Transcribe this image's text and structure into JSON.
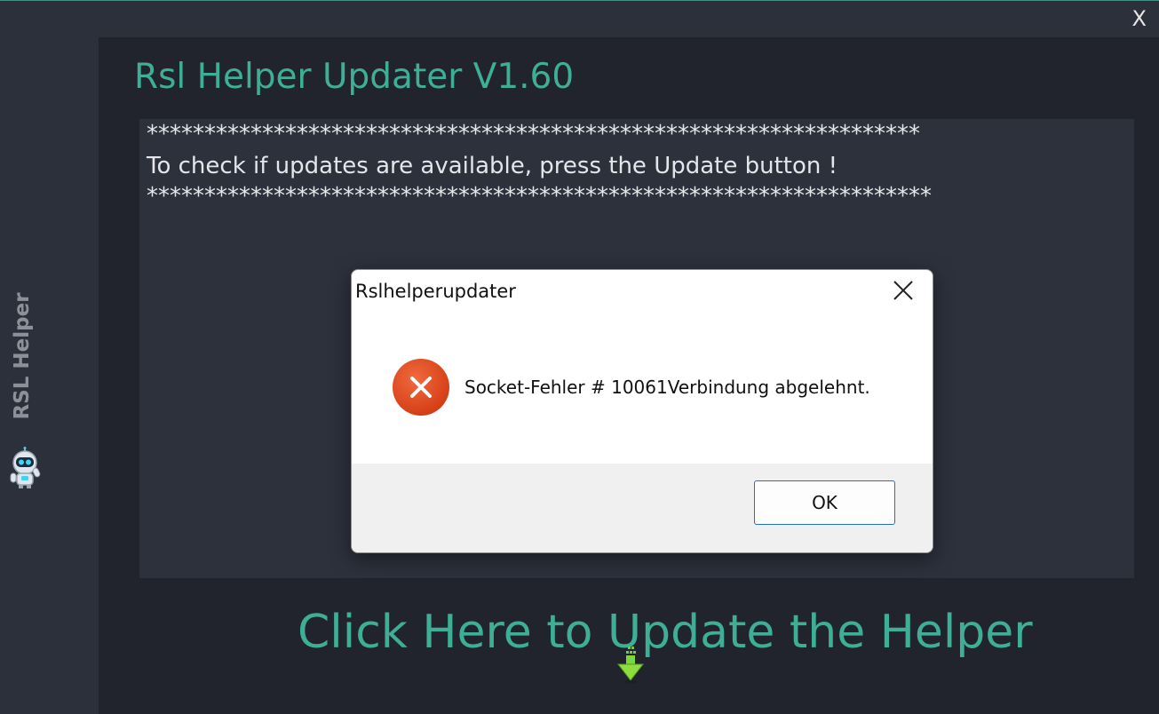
{
  "window": {
    "close_label": "X"
  },
  "sidebar": {
    "title": "RSL Helper",
    "logo_icon": "robot-mascot-icon"
  },
  "app": {
    "title": "Rsl Helper Updater V1.60"
  },
  "log": {
    "lines": [
      "*******************************************************************",
      "To check if updates are available, press the Update button !",
      "********************************************************************"
    ]
  },
  "update": {
    "link_label": "Click Here to Update the Helper",
    "icon": "download-arrow-icon"
  },
  "dialog": {
    "title": "Rslhelperupdater",
    "message": "Socket-Fehler # 10061Verbindung abgelehnt.",
    "ok_label": "OK",
    "icon": "error-icon"
  },
  "colors": {
    "accent": "#3fae97",
    "background": "#21242d",
    "error": "#d64018"
  }
}
